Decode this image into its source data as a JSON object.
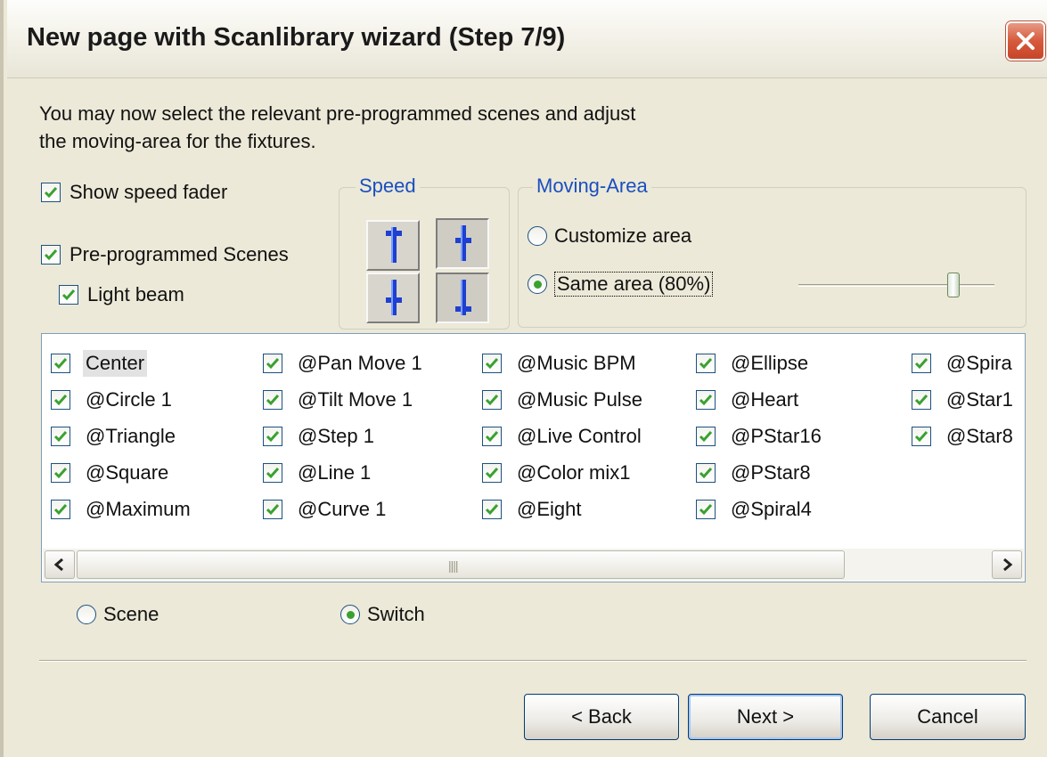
{
  "window": {
    "title": "New page with Scanlibrary wizard (Step 7/9)"
  },
  "intro": {
    "line1": "You may now select the relevant pre-programmed scenes and adjust",
    "line2": "the moving-area for the fixtures."
  },
  "options": {
    "show_speed_fader": {
      "label": "Show speed fader",
      "checked": true
    },
    "preprogrammed_scenes": {
      "label": "Pre-programmed Scenes",
      "checked": true
    },
    "light_beam": {
      "label": "Light beam",
      "checked": true
    }
  },
  "speed": {
    "label": "Speed",
    "buttons": [
      "speed-up-icon",
      "speed-fader-icon",
      "speed-down-icon",
      "speed-min-icon"
    ]
  },
  "moving_area": {
    "label": "Moving-Area",
    "customize_label": "Customize area",
    "same_area_label": "Same area (80%)",
    "selected": "same_area",
    "slider_level_percent": 80
  },
  "scenes": {
    "columns": [
      [
        "Center",
        "@Circle 1",
        "@Triangle",
        "@Square",
        "@Maximum"
      ],
      [
        "@Pan Move 1",
        "@Tilt Move 1",
        "@Step 1",
        "@Line 1",
        "@Curve 1"
      ],
      [
        "@Music BPM",
        "@Music Pulse",
        "@Live Control",
        "@Color mix1",
        "@Eight"
      ],
      [
        "@Ellipse",
        "@Heart",
        "@PStar16",
        "@PStar8",
        "@Spiral4"
      ],
      [
        "@Spira",
        "@Star1",
        "@Star8"
      ]
    ],
    "selected": "Center"
  },
  "mode": {
    "scene_label": "Scene",
    "switch_label": "Switch",
    "selected": "switch"
  },
  "buttons": {
    "back": "< Back",
    "next": "Next >",
    "cancel": "Cancel"
  },
  "colors": {
    "accent_blue": "#1a4fc0",
    "check_green": "#3aa130",
    "close_red": "#d65a3c"
  }
}
